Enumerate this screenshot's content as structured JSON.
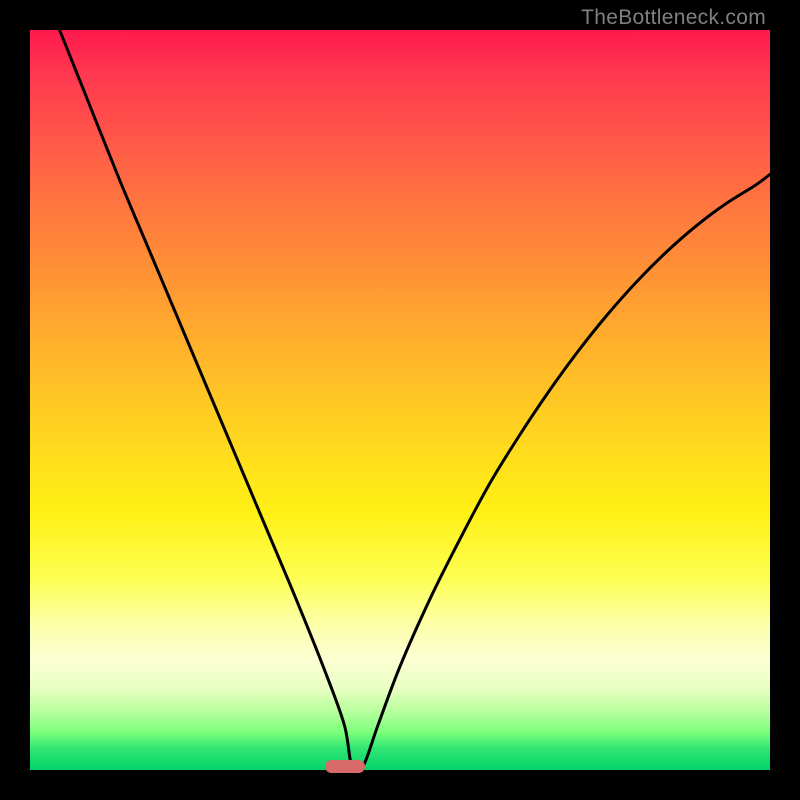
{
  "watermark": "TheBottleneck.com",
  "chart_data": {
    "type": "line",
    "title": "",
    "xlabel": "",
    "ylabel": "",
    "xlim": [
      0,
      100
    ],
    "ylim": [
      0,
      100
    ],
    "series": [
      {
        "name": "bottleneck-curve",
        "x": [
          4,
          8,
          12,
          16,
          20,
          24,
          28,
          32,
          36,
          40,
          42.5,
          43.5,
          45,
          47,
          50,
          54,
          58,
          62,
          66,
          70,
          74,
          78,
          82,
          86,
          90,
          94,
          98,
          100
        ],
        "y": [
          100,
          90,
          80,
          70.5,
          61,
          51.5,
          42,
          32.5,
          23,
          13,
          6,
          0.5,
          0.5,
          6,
          14,
          23,
          31,
          38.5,
          45,
          51,
          56.5,
          61.5,
          66,
          70,
          73.5,
          76.5,
          79,
          80.5
        ]
      }
    ],
    "marker": {
      "x_percent": 42.5,
      "y_percent": 0
    },
    "background_gradient": {
      "top_color": "#ff1a4d",
      "mid_color": "#ffe014",
      "bottom_color": "#00d46a"
    }
  }
}
